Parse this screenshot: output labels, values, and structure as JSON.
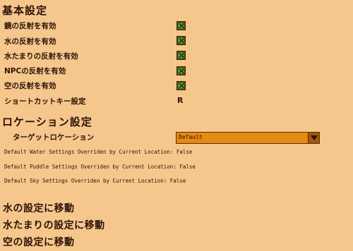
{
  "basic": {
    "header": "基本設定",
    "options": [
      {
        "label": "鏡の反射を有効",
        "checked": true
      },
      {
        "label": "水の反射を有効",
        "checked": true
      },
      {
        "label": "水たまりの反射を有効",
        "checked": true
      },
      {
        "label": "NPCの反射を有効",
        "checked": true
      },
      {
        "label": "空の反射を有効",
        "checked": true
      }
    ],
    "shortcut_label": "ショートカットキー設定",
    "shortcut_value": "R"
  },
  "location": {
    "header": "ロケーション設定",
    "target_label": "ターゲットロケーション",
    "target_value": "Default",
    "info_lines": [
      "Default Water Settings Overriden by Current Location: False",
      "Default Puddle Settings Overriden by Current Location: False",
      "Default Sky Settings Overriden by Current Location: False"
    ]
  },
  "links": [
    "水の設定に移動",
    "水たまりの設定に移動",
    "空の設定に移動"
  ],
  "colors": {
    "background": "#f6c78c",
    "text": "#2b1208",
    "checkbox_fill": "#59c34a",
    "dropdown_fill": "#e58a12"
  }
}
